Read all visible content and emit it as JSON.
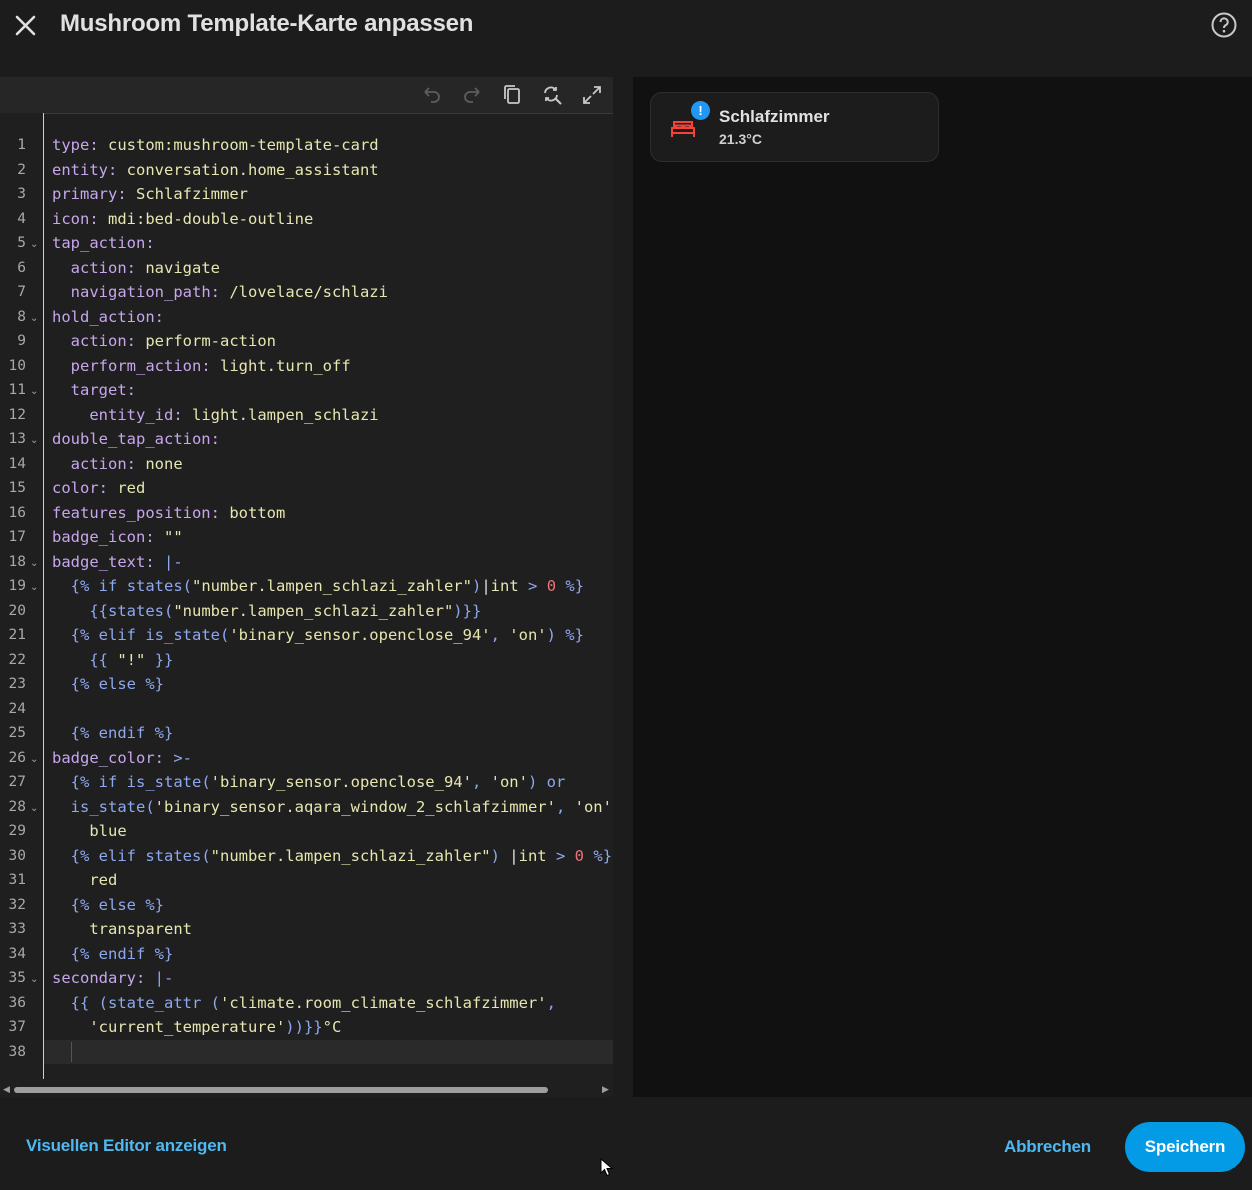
{
  "header": {
    "title": "Mushroom Template-Karte anpassen",
    "close_icon": "close-icon",
    "help_icon": "help-circle-icon"
  },
  "editor": {
    "toolbar": [
      "undo-icon",
      "redo-icon",
      "copy-icon",
      "search-replace-icon",
      "fullscreen-icon"
    ],
    "lines": [
      {
        "n": "1",
        "fold": false,
        "html": "<span class=\"k\">type:</span> <span class=\"s\">custom:mushroom-template-card</span>"
      },
      {
        "n": "2",
        "fold": false,
        "html": "<span class=\"k\">entity:</span> <span class=\"s\">conversation.home_assistant</span>"
      },
      {
        "n": "3",
        "fold": false,
        "html": "<span class=\"k\">primary:</span> <span class=\"s\">Schlafzimmer</span>"
      },
      {
        "n": "4",
        "fold": false,
        "html": "<span class=\"k\">icon:</span> <span class=\"s\">mdi:bed-double-outline</span>"
      },
      {
        "n": "5",
        "fold": true,
        "html": "<span class=\"k\">tap_action:</span>"
      },
      {
        "n": "6",
        "fold": false,
        "html": "  <span class=\"k\">action:</span> <span class=\"s\">navigate</span>"
      },
      {
        "n": "7",
        "fold": false,
        "html": "  <span class=\"k\">navigation_path:</span> <span class=\"s\">/lovelace/schlazi</span>"
      },
      {
        "n": "8",
        "fold": true,
        "html": "<span class=\"k\">hold_action:</span>"
      },
      {
        "n": "9",
        "fold": false,
        "html": "  <span class=\"k\">action:</span> <span class=\"s\">perform-action</span>"
      },
      {
        "n": "10",
        "fold": false,
        "html": "  <span class=\"k\">perform_action:</span> <span class=\"s\">light.turn_off</span>"
      },
      {
        "n": "11",
        "fold": true,
        "html": "  <span class=\"k\">target:</span>"
      },
      {
        "n": "12",
        "fold": false,
        "html": "    <span class=\"k\">entity_id:</span> <span class=\"s\">light.lampen_schlazi</span>"
      },
      {
        "n": "13",
        "fold": true,
        "html": "<span class=\"k\">double_tap_action:</span>"
      },
      {
        "n": "14",
        "fold": false,
        "html": "  <span class=\"k\">action:</span> <span class=\"s\">none</span>"
      },
      {
        "n": "15",
        "fold": false,
        "html": "<span class=\"k\">color:</span> <span class=\"s\">red</span>"
      },
      {
        "n": "16",
        "fold": false,
        "html": "<span class=\"k\">features_position:</span> <span class=\"s\">bottom</span>"
      },
      {
        "n": "17",
        "fold": false,
        "html": "<span class=\"k\">badge_icon:</span> <span class=\"s\">\"\"</span>"
      },
      {
        "n": "18",
        "fold": true,
        "html": "<span class=\"k\">badge_text:</span> <span class=\"j\">|-</span>"
      },
      {
        "n": "19",
        "fold": true,
        "html": "  <span class=\"j\">{% if</span> <span class=\"j\">states(</span><span class=\"s\">\"number.lampen_schlazi_zahler\"</span><span class=\"j\">)</span>|<span class=\"s\">int</span> <span class=\"j\">&gt;</span> <span class=\"n\">0</span> <span class=\"j\">%}</span>"
      },
      {
        "n": "20",
        "fold": false,
        "html": "    <span class=\"j\">{{states(</span><span class=\"s\">\"number.lampen_schlazi_zahler\"</span><span class=\"j\">)}}</span>"
      },
      {
        "n": "21",
        "fold": false,
        "html": "  <span class=\"j\">{% elif is_state(</span><span class=\"s\">'binary_sensor.openclose_94'</span><span class=\"j\">,</span> <span class=\"s\">'on'</span><span class=\"j\">) %}</span>"
      },
      {
        "n": "22",
        "fold": false,
        "html": "    <span class=\"j\">{{</span> <span class=\"s\">\"!\"</span> <span class=\"j\">}}</span>"
      },
      {
        "n": "23",
        "fold": false,
        "html": "  <span class=\"j\">{% else %}</span>"
      },
      {
        "n": "24",
        "fold": false,
        "html": ""
      },
      {
        "n": "25",
        "fold": false,
        "html": "  <span class=\"j\">{% endif %}</span>"
      },
      {
        "n": "26",
        "fold": true,
        "html": "<span class=\"k\">badge_color:</span> <span class=\"j\">&gt;-</span>"
      },
      {
        "n": "27",
        "fold": false,
        "html": "  <span class=\"j\">{% if is_state(</span><span class=\"s\">'binary_sensor.openclose_94'</span><span class=\"j\">,</span> <span class=\"s\">'on'</span><span class=\"j\">) or</span>"
      },
      {
        "n": "28",
        "fold": true,
        "html": "  <span class=\"j\">is_state(</span><span class=\"s\">'binary_sensor.aqara_window_2_schlafzimmer'</span><span class=\"j\">,</span> <span class=\"s\">'on'</span>"
      },
      {
        "n": "29",
        "fold": false,
        "html": "    <span class=\"s\">blue</span>"
      },
      {
        "n": "30",
        "fold": false,
        "html": "  <span class=\"j\">{% elif states(</span><span class=\"s\">\"number.lampen_schlazi_zahler\"</span><span class=\"j\">)</span> |<span class=\"s\">int</span> <span class=\"j\">&gt;</span> <span class=\"n\">0</span> <span class=\"j\">%}</span>"
      },
      {
        "n": "31",
        "fold": false,
        "html": "    <span class=\"s\">red</span>"
      },
      {
        "n": "32",
        "fold": false,
        "html": "  <span class=\"j\">{% else %}</span>"
      },
      {
        "n": "33",
        "fold": false,
        "html": "    <span class=\"s\">transparent</span>"
      },
      {
        "n": "34",
        "fold": false,
        "html": "  <span class=\"j\">{% endif %}</span>"
      },
      {
        "n": "35",
        "fold": true,
        "html": "<span class=\"k\">secondary:</span> <span class=\"j\">|-</span>"
      },
      {
        "n": "36",
        "fold": false,
        "html": "  <span class=\"j\">{{ (state_attr (</span><span class=\"s\">'climate.room_climate_schlafzimmer'</span><span class=\"j\">,</span>"
      },
      {
        "n": "37",
        "fold": false,
        "html": "    <span class=\"s\">'current_temperature'</span><span class=\"j\">))}}</span><span class=\"s\">°C</span>"
      },
      {
        "n": "38",
        "fold": false,
        "html": ""
      }
    ]
  },
  "preview": {
    "card": {
      "primary": "Schlafzimmer",
      "secondary": "21.3°C",
      "badge": "!",
      "icon": "bed-double-outline-icon",
      "icon_color": "#f44336",
      "badge_color": "#2196f3"
    }
  },
  "footer": {
    "visual_editor_label": "Visuellen Editor anzeigen",
    "cancel_label": "Abbrechen",
    "save_label": "Speichern"
  }
}
